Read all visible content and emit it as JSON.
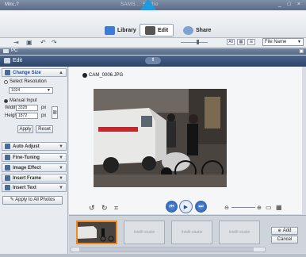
{
  "window": {
    "app_name": "Mini..?",
    "title": "SAMS...                Studio",
    "controls": "_ □ ×"
  },
  "modes": {
    "library": "Library",
    "edit": "Edit",
    "share": "Share"
  },
  "toolbar": {
    "sort_value": "File Name",
    "view_all": "All"
  },
  "pc_bar": {
    "label": "PC"
  },
  "edit_bar": {
    "label": "Edit"
  },
  "change_size": {
    "header": "Change Size",
    "select_resolution": "Select Resolution",
    "resolution_value": "1024",
    "manual_input": "Manual Input",
    "width_label": "Width",
    "width_value": "3328",
    "height_label": "Height",
    "height_value": "1872",
    "unit": "px",
    "apply": "Apply",
    "reset": "Reset"
  },
  "tools": [
    {
      "label": "Auto Adjust"
    },
    {
      "label": "Fine-Tuning"
    },
    {
      "label": "Image Effect"
    },
    {
      "label": "Insert Frame"
    },
    {
      "label": "Insert Text"
    }
  ],
  "apply_all": "Apply to All Photos",
  "viewer": {
    "filename": "CAM_0006.JPG"
  },
  "filmstrip": {
    "placeholder": "Intelli-studio",
    "add": "Add",
    "cancel": "Cancel"
  }
}
